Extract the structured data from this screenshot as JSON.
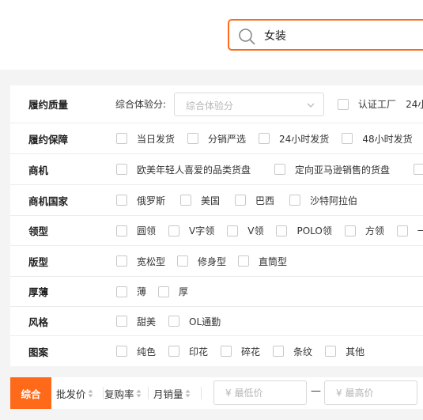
{
  "search": {
    "value": "女装"
  },
  "filters": {
    "fulfillment_quality": {
      "label": "履约质量",
      "experience_label": "综合体验分:",
      "experience_placeholder": "综合体验分",
      "options": [
        "认证工厂",
        "24小"
      ]
    },
    "fulfillment_guarantee": {
      "label": "履约保障",
      "options": [
        "当日发货",
        "分销严选",
        "24小时发货",
        "48小时发货"
      ]
    },
    "opportunity": {
      "label": "商机",
      "options": [
        "欧美年轻人喜爱的品类货盘",
        "定向亚马逊销售的货盘"
      ]
    },
    "opportunity_country": {
      "label": "商机国家",
      "options": [
        "俄罗斯",
        "美国",
        "巴西",
        "沙特阿拉伯"
      ]
    },
    "collar": {
      "label": "领型",
      "options": [
        "圆领",
        "V字领",
        "V领",
        "POLO领",
        "方领",
        "一"
      ]
    },
    "fit": {
      "label": "版型",
      "options": [
        "宽松型",
        "修身型",
        "直筒型"
      ]
    },
    "thickness": {
      "label": "厚薄",
      "options": [
        "薄",
        "厚"
      ]
    },
    "style": {
      "label": "风格",
      "options": [
        "甜美",
        "OL通勤"
      ]
    },
    "pattern": {
      "label": "图案",
      "options": [
        "纯色",
        "印花",
        "碎花",
        "条纹",
        "其他"
      ]
    }
  },
  "sort_bar": {
    "active": "综合",
    "items": [
      "批发价",
      "复购率",
      "月销量"
    ],
    "price_min_placeholder": "¥ 最低价",
    "price_max_placeholder": "¥ 最高价",
    "price_separator": "—"
  },
  "colors": {
    "accent": "#ff6a1a",
    "page_background": "#f4f4f4",
    "panel_background": "#ffffff"
  }
}
